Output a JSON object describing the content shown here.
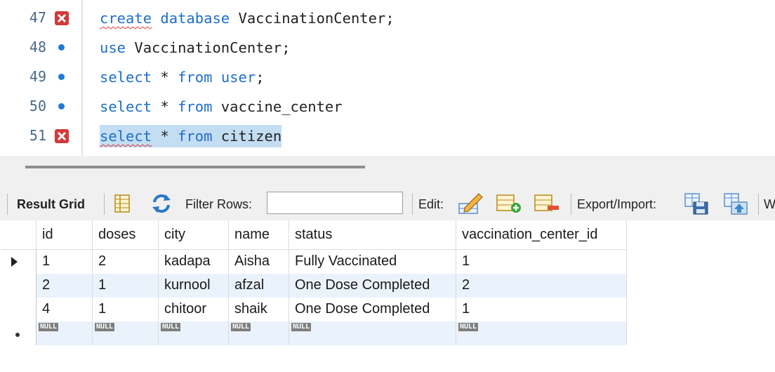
{
  "editor": {
    "lines": [
      {
        "num": "47",
        "status": "error",
        "tokens": [
          {
            "t": "create",
            "c": "kw squig"
          },
          {
            "t": " "
          },
          {
            "t": "database",
            "c": "kw"
          },
          {
            "t": " VaccinationCenter;"
          }
        ]
      },
      {
        "num": "48",
        "status": "ok",
        "tokens": [
          {
            "t": "use",
            "c": "kw"
          },
          {
            "t": " VaccinationCenter;"
          }
        ]
      },
      {
        "num": "49",
        "status": "ok",
        "tokens": [
          {
            "t": "select",
            "c": "kw"
          },
          {
            "t": " * "
          },
          {
            "t": "from",
            "c": "kw"
          },
          {
            "t": " "
          },
          {
            "t": "user",
            "c": "kw"
          },
          {
            "t": ";"
          }
        ]
      },
      {
        "num": "50",
        "status": "ok",
        "tokens": [
          {
            "t": "select",
            "c": "kw"
          },
          {
            "t": " * "
          },
          {
            "t": "from",
            "c": "kw"
          },
          {
            "t": " vaccine_center"
          }
        ]
      },
      {
        "num": "51",
        "status": "error",
        "selected": true,
        "tokens": [
          {
            "t": "select",
            "c": "kw squig"
          },
          {
            "t": " * "
          },
          {
            "t": "from",
            "c": "kw"
          },
          {
            "t": " citizen"
          }
        ]
      }
    ]
  },
  "toolbar": {
    "result_grid_label": "Result Grid",
    "filter_rows_label": "Filter Rows:",
    "filter_value": "",
    "edit_label": "Edit:",
    "export_import_label": "Export/Import:",
    "truncated_label": "W"
  },
  "grid": {
    "columns": [
      "id",
      "doses",
      "city",
      "name",
      "status",
      "vaccination_center_id"
    ],
    "rows": [
      [
        "1",
        "2",
        "kadapa",
        "Aisha",
        "Fully Vaccinated",
        "1"
      ],
      [
        "2",
        "1",
        "kurnool",
        "afzal",
        "One Dose Completed",
        "2"
      ],
      [
        "4",
        "1",
        "chitoor",
        "shaik",
        "One Dose Completed",
        "1"
      ]
    ],
    "null_label": "NULL"
  },
  "colors": {
    "keyword": "#1d6fc9",
    "selection": "#c3ddf3",
    "row_stripe": "#eaf2fb",
    "error_marker": "#d23a3a",
    "ok_marker": "#1f7ad8"
  }
}
